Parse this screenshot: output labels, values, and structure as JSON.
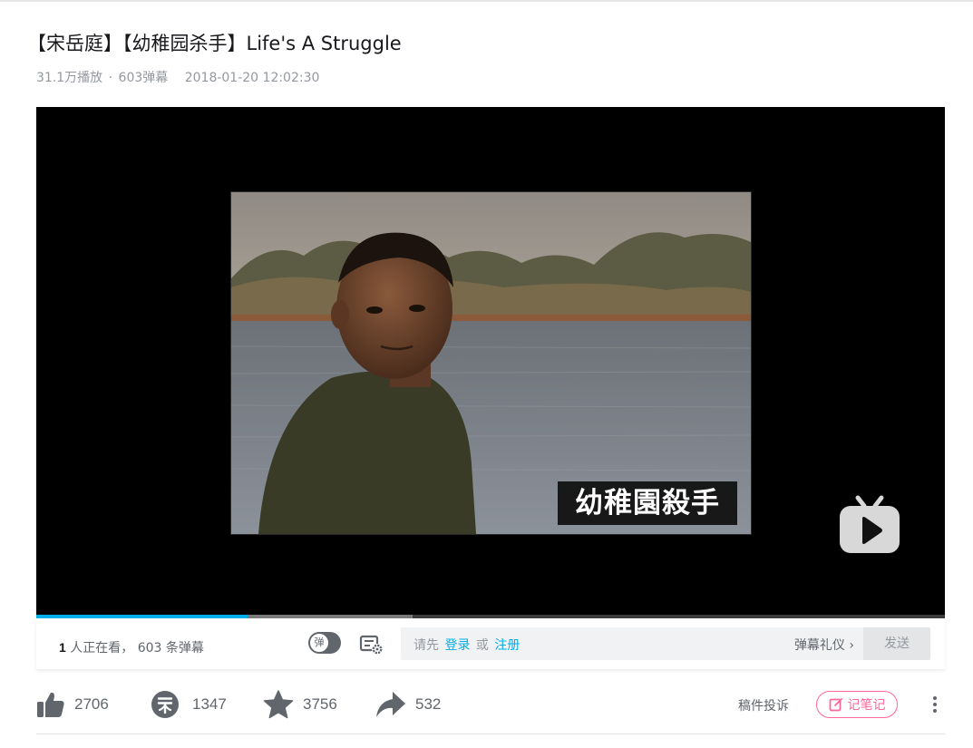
{
  "video": {
    "title": "【宋岳庭】【幼稚园杀手】Life's A Struggle",
    "plays": "31.1万播放",
    "separator": "·",
    "danmaku_count": "603弹幕",
    "date": "2018-01-20 12:02:30"
  },
  "player": {
    "caption": "幼稚園殺手",
    "played_fraction": 0.233,
    "buffered_fraction": 0.414
  },
  "danmaku_bar": {
    "viewers_count": "1",
    "viewers_text": "人正在看，",
    "danmaku_total": "603",
    "danmaku_text": "条弹幕",
    "toggle_label": "弹",
    "hint_prefix": "请先",
    "login": "登录",
    "or": "或",
    "register": "注册",
    "etiquette": "弹幕礼仪 ›",
    "send": "发送"
  },
  "toolbar": {
    "like": "2706",
    "coin": "1347",
    "favorite": "3756",
    "share": "532",
    "report": "稿件投诉",
    "notes": "记笔记"
  },
  "colors": {
    "accent": "#00aeec",
    "pink": "#ff6699",
    "icon_gray": "#61666d"
  }
}
